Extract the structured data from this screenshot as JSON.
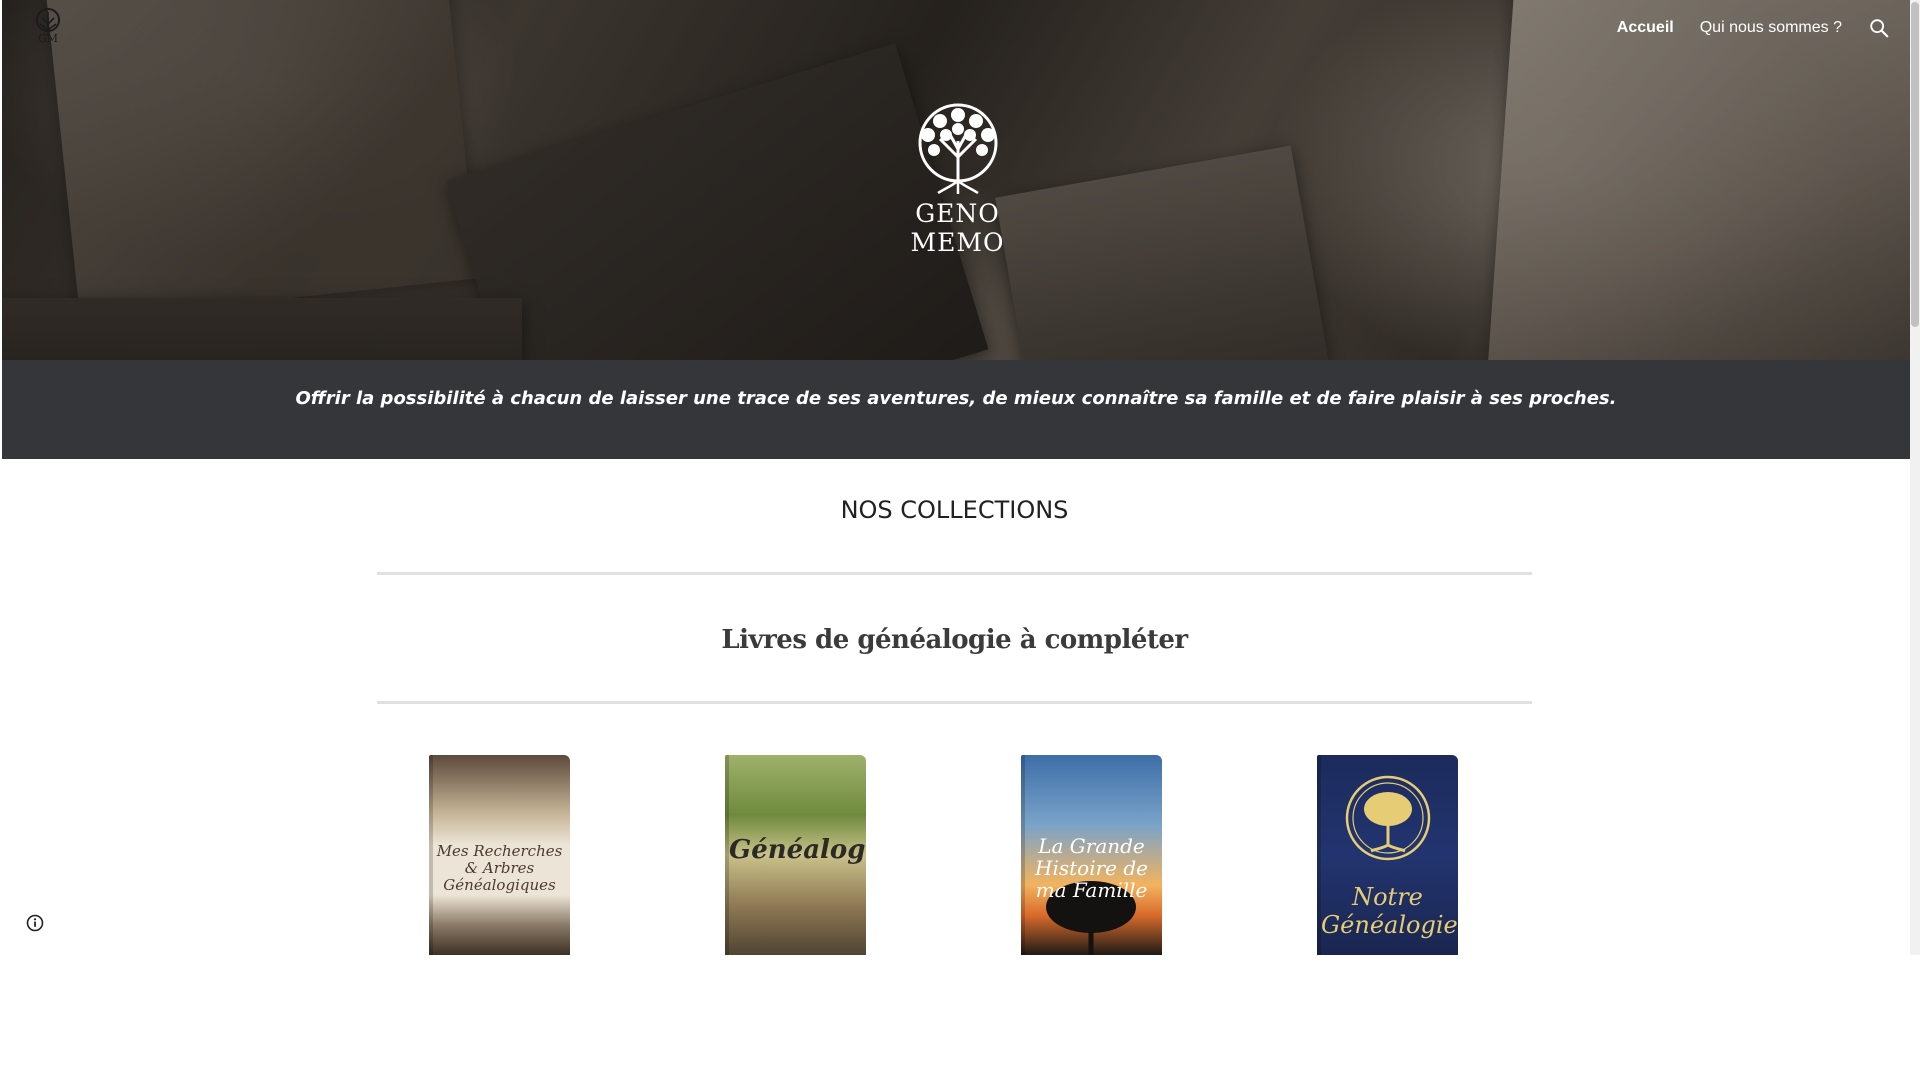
{
  "header": {
    "logo_icon": "gm-tree-logo-icon",
    "nav": [
      {
        "label": "Accueil",
        "active": true
      },
      {
        "label": "Qui nous sommes ?",
        "active": false
      }
    ],
    "search_icon": "search-icon"
  },
  "hero": {
    "brand_name": "GENO MEMO",
    "brand_icon": "tree-of-life-icon"
  },
  "tagline": "Offrir la possibilité à chacun de laisser une trace de ses aventures, de mieux connaître sa famille et de faire plaisir à ses proches.",
  "section": {
    "title": "NOS COLLECTIONS",
    "subtitle": "Livres de généalogie à compléter"
  },
  "books": [
    {
      "cover_title": "Mes Recherches & Arbres Généalogiques"
    },
    {
      "cover_title": "Généalogie"
    },
    {
      "cover_title": "La Grande Histoire de ma Famille"
    },
    {
      "cover_title": "Notre Généalogie"
    }
  ],
  "footer": {
    "info_icon": "info-icon"
  },
  "colors": {
    "band": "#34363a",
    "title": "#212121",
    "rule": "#e0e0e0"
  }
}
